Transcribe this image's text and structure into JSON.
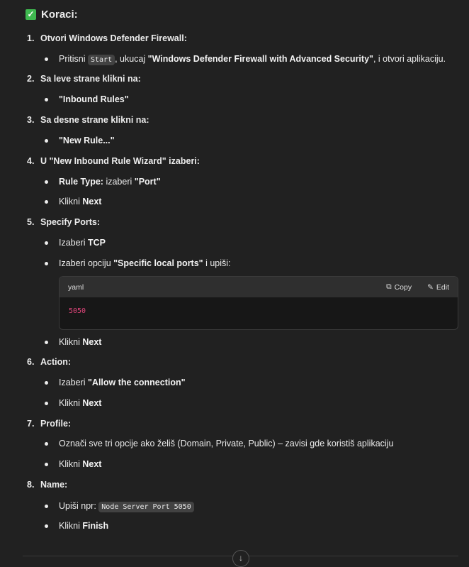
{
  "heading": {
    "icon": "check-box-icon",
    "text": "Koraci:"
  },
  "steps": [
    {
      "n": "1.",
      "title": "Otvori Windows Defender Firewall:",
      "bullets": [
        {
          "a": "Pritisni ",
          "code": "Start",
          "b": ", ukucaj ",
          "bold": "\"Windows Defender Firewall with Advanced Security\"",
          "c": ", i otvori aplikaciju."
        }
      ]
    },
    {
      "n": "2.",
      "title": "Sa leve strane klikni na:",
      "bullets": [
        {
          "bold": "\"Inbound Rules\""
        }
      ]
    },
    {
      "n": "3.",
      "title": "Sa desne strane klikni na:",
      "bullets": [
        {
          "bold": "\"New Rule...\""
        }
      ]
    },
    {
      "n": "4.",
      "title": "U \"New Inbound Rule Wizard\" izaberi:",
      "bullets": [
        {
          "bold": "Rule Type:",
          "a": " izaberi ",
          "bold2": "\"Port\""
        },
        {
          "a": "Klikni ",
          "bold": "Next"
        }
      ]
    },
    {
      "n": "5.",
      "title": "Specify Ports:",
      "bullets": [
        {
          "a": "Izaberi ",
          "bold": "TCP"
        },
        {
          "a": "Izaberi opciju ",
          "bold": "\"Specific local ports\"",
          "c": " i upiši:"
        },
        {
          "a": "Klikni ",
          "bold": "Next"
        }
      ]
    },
    {
      "n": "6.",
      "title": "Action:",
      "bullets": [
        {
          "a": "Izaberi ",
          "bold": "\"Allow the connection\""
        },
        {
          "a": "Klikni ",
          "bold": "Next"
        }
      ]
    },
    {
      "n": "7.",
      "title": "Profile:",
      "bullets": [
        {
          "a": "Označi sve tri opcije ako želiš (Domain, Private, Public) – zavisi gde koristiš aplikaciju"
        },
        {
          "a": "Klikni ",
          "bold": "Next"
        }
      ]
    },
    {
      "n": "8.",
      "title": "Name:",
      "bullets": [
        {
          "a": "Upiši npr: ",
          "code": "Node Server Port 5050"
        },
        {
          "a": "Klikni ",
          "bold": "Finish"
        }
      ]
    }
  ],
  "code_block": {
    "language": "yaml",
    "copy": "Copy",
    "edit": "Edit",
    "code": "5050",
    "code_color": "#e0457b"
  },
  "accent": "#3fb950"
}
